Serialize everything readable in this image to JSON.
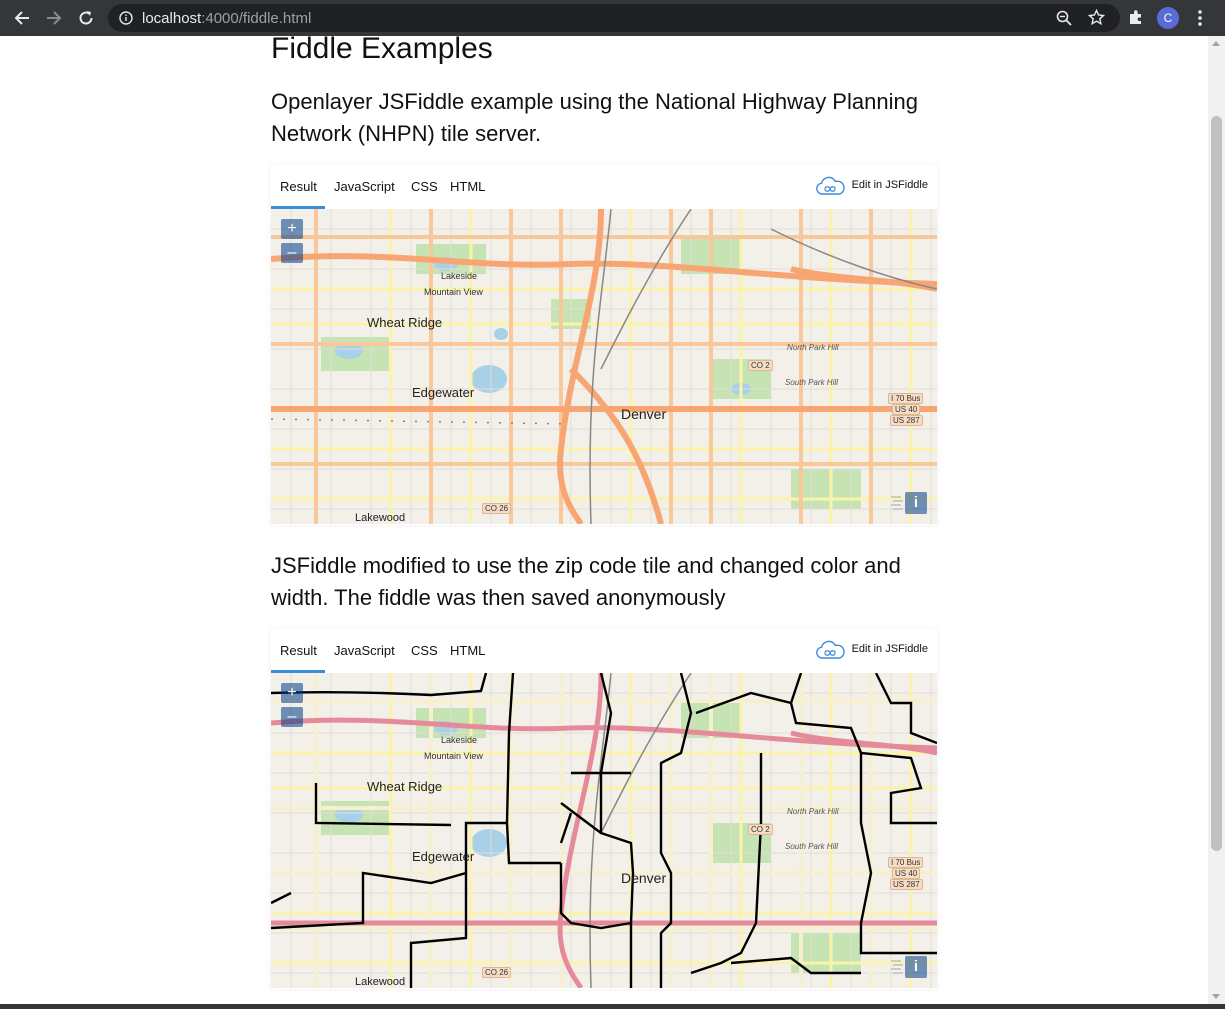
{
  "browser": {
    "url_host": "localhost",
    "url_rest": ":4000/fiddle.html",
    "profile_initial": "C"
  },
  "page": {
    "title": "Fiddle Examples",
    "para1": "Openlayer JSFiddle example using the National Highway Planning Network (NHPN) tile server.",
    "para2": "JSFiddle modified to use the zip code tile and changed color and width. The fiddle was then saved anonymously"
  },
  "fiddle": {
    "tabs": [
      "Result",
      "JavaScript",
      "CSS",
      "HTML"
    ],
    "edit_label": "Edit in JSFiddle",
    "zoom_in": "+",
    "zoom_out": "–",
    "info": "i"
  },
  "map_labels": {
    "wheat_ridge": "Wheat Ridge",
    "edgewater": "Edgewater",
    "denver": "Denver",
    "lakewood": "Lakewood",
    "lakeside": "Lakeside",
    "mountain_view": "Mountain View",
    "north_park_hill": "North Park Hill",
    "south_park_hill": "South Park Hill",
    "co2": "CO 2",
    "co26": "CO 26",
    "i70bus": "I 70 Bus",
    "us40": "US 40",
    "us287": "US 287"
  },
  "colors": {
    "accent": "#3b8cdd",
    "highway": "#f7a673",
    "major": "#f9c89a",
    "minor": "#fbf4a8",
    "park": "#c6e3b4",
    "water": "#a8d0e6",
    "zip_border": "#000000"
  }
}
